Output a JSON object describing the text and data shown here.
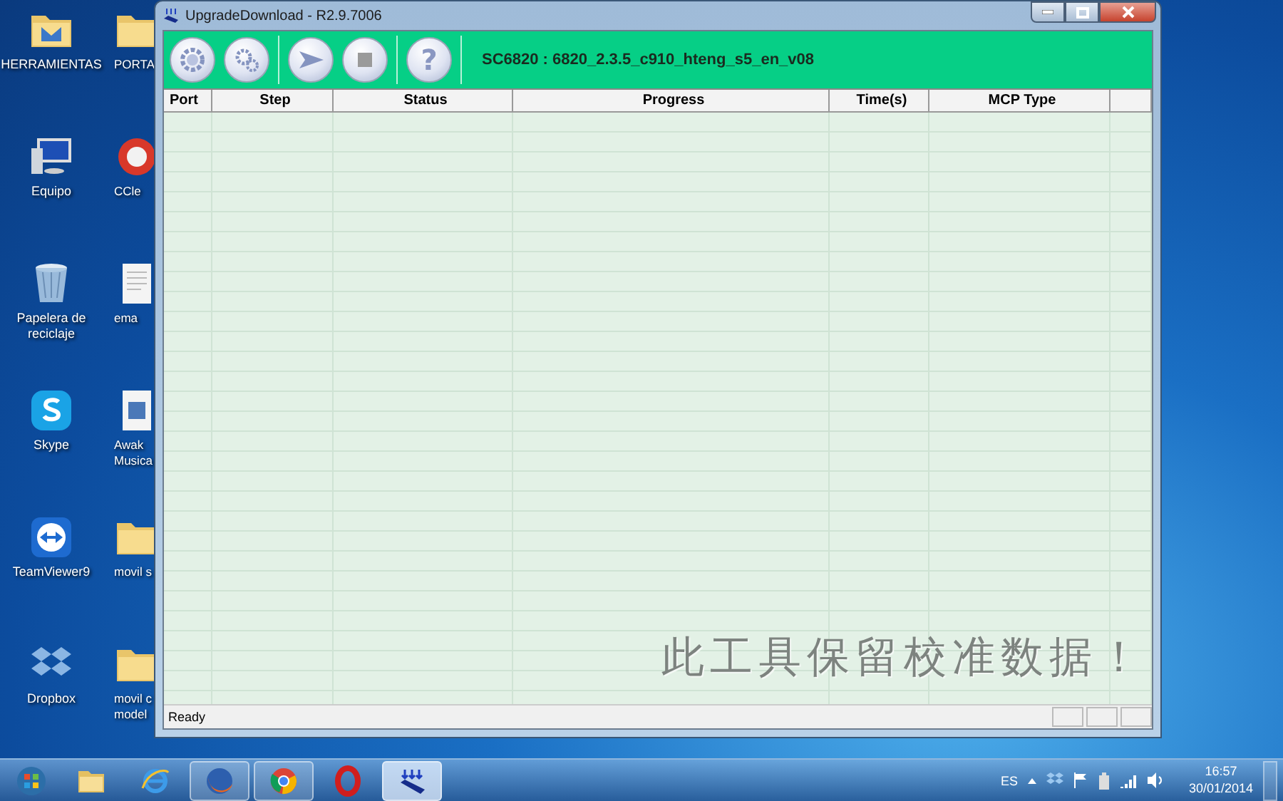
{
  "desktop_icon_columns": [
    [
      {
        "label": "HERRAMIENTAS",
        "kind": "folder-tool"
      },
      {
        "label": "Equipo",
        "kind": "computer"
      },
      {
        "label": "Papelera de reciclaje",
        "kind": "bin"
      },
      {
        "label": "Skype",
        "kind": "skype"
      },
      {
        "label": "TeamViewer9",
        "kind": "teamviewer"
      },
      {
        "label": "Dropbox",
        "kind": "dropbox"
      }
    ],
    [
      {
        "label": "PORTA",
        "kind": "folder"
      },
      {
        "label": "CCle",
        "kind": "ccleaner"
      },
      {
        "label": "ema",
        "kind": "document"
      },
      {
        "label": "Awak Musica",
        "kind": "installer"
      },
      {
        "label": "movil s",
        "kind": "folder"
      },
      {
        "label": "movil c model",
        "kind": "folder"
      }
    ]
  ],
  "window": {
    "title": "UpgradeDownload - R2.9.7006",
    "toolbar": [
      {
        "kind": "settings"
      },
      {
        "kind": "gears"
      },
      {
        "kind": "start"
      },
      {
        "kind": "stop"
      },
      {
        "kind": "help",
        "text": "?"
      }
    ],
    "firmware": "SC6820 : 6820_2.3.5_c910_hteng_s5_en_v08",
    "columns": [
      "Port",
      "Step",
      "Status",
      "Progress",
      "Time(s)",
      "MCP Type",
      ""
    ],
    "overlay_text": "此工具保留校准数据！",
    "status": "Ready"
  },
  "taskbar": [
    {
      "kind": "start",
      "running": false,
      "selected": false
    },
    {
      "kind": "explorer",
      "running": false,
      "selected": false
    },
    {
      "kind": "ie",
      "running": false,
      "selected": false
    },
    {
      "kind": "firefox",
      "running": true,
      "selected": false
    },
    {
      "kind": "chrome",
      "running": true,
      "selected": false
    },
    {
      "kind": "opera",
      "running": false,
      "selected": false
    },
    {
      "kind": "download-tool",
      "running": true,
      "selected": true
    }
  ],
  "tray": {
    "language": "ES",
    "time": "16:57",
    "date": "30/01/2014"
  }
}
